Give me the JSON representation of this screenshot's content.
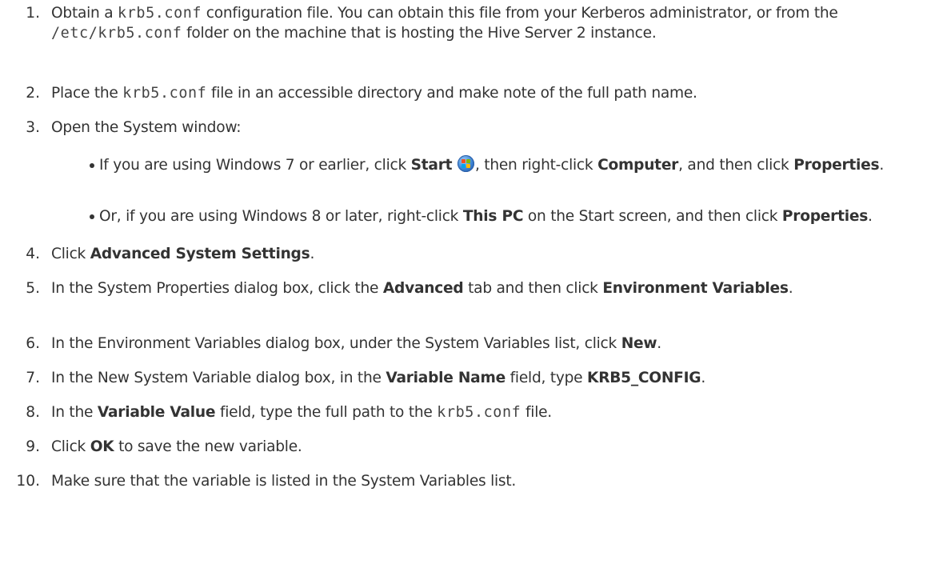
{
  "steps": [
    {
      "num": "1.",
      "parts": [
        "Obtain a ",
        "krb5.conf",
        " configuration file. You can obtain this file from your Kerberos administrator, or from the ",
        "/etc/krb5.conf",
        " folder on the machine that is hosting the Hive Server 2 instance."
      ]
    },
    {
      "num": "2.",
      "parts": [
        "Place the ",
        "krb5.conf",
        " file in an accessible directory and make note of the full path name."
      ]
    },
    {
      "num": "3.",
      "text": "Open the System window:",
      "bullets": [
        {
          "parts": [
            "If you are using Windows 7 or earlier, click ",
            "Start",
            ", then right-click ",
            "Computer",
            ", and then click ",
            "Properties",
            "."
          ],
          "icon": "windows-start-orb-icon"
        },
        {
          "parts": [
            "Or, if you are using Windows 8 or later, right-click ",
            "This PC",
            " on the Start screen, and then click ",
            "Properties",
            "."
          ]
        }
      ]
    },
    {
      "num": "4.",
      "parts": [
        "Click ",
        "Advanced System Settings",
        "."
      ]
    },
    {
      "num": "5.",
      "parts": [
        "In the System Properties dialog box, click the ",
        "Advanced",
        " tab and then click ",
        "Environment Variables",
        "."
      ]
    },
    {
      "num": "6.",
      "parts": [
        "In the Environment Variables dialog box, under the System Variables list, click ",
        "New",
        "."
      ]
    },
    {
      "num": "7.",
      "parts": [
        "In the New System Variable dialog box, in the ",
        "Variable Name",
        " field, type ",
        "KRB5_CONFIG",
        "."
      ]
    },
    {
      "num": "8.",
      "parts": [
        "In the ",
        "Variable Value",
        " field, type the full path to the ",
        "krb5.conf",
        " file."
      ]
    },
    {
      "num": "9.",
      "parts": [
        "Click ",
        "OK",
        " to save the new variable."
      ]
    },
    {
      "num": "10.",
      "text": "Make sure that the variable is listed in the System Variables list."
    }
  ],
  "colors": {
    "text": "#333333",
    "code": "#444444",
    "start_orb": "#3a7fcf"
  }
}
